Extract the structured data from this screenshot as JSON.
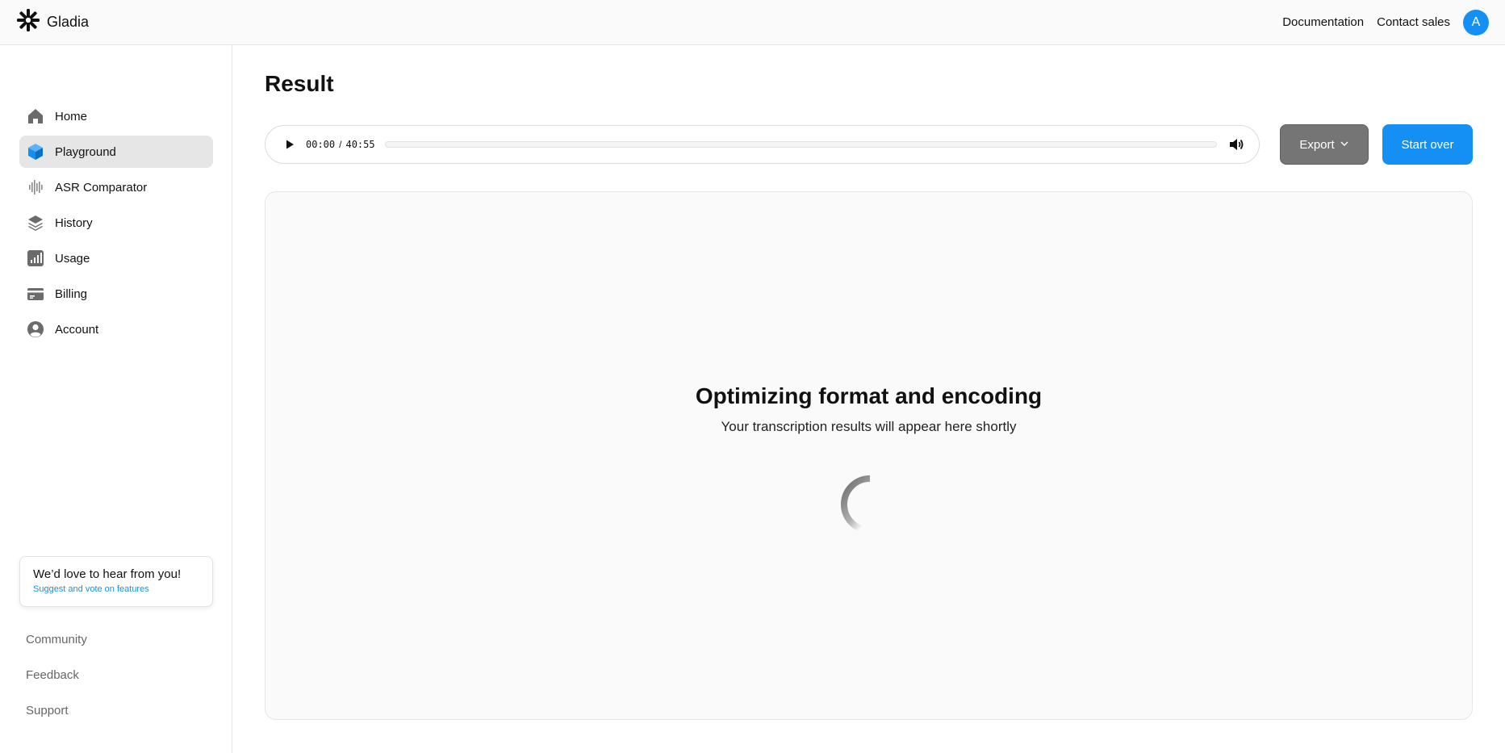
{
  "header": {
    "brand": "Gladia",
    "links": {
      "documentation": "Documentation",
      "contact_sales": "Contact sales"
    },
    "avatar_initial": "A"
  },
  "sidebar": {
    "items": [
      {
        "label": "Home",
        "icon": "home-icon",
        "active": false
      },
      {
        "label": "Playground",
        "icon": "cube-icon",
        "active": true
      },
      {
        "label": "ASR Comparator",
        "icon": "waveform-icon",
        "active": false
      },
      {
        "label": "History",
        "icon": "layers-icon",
        "active": false
      },
      {
        "label": "Usage",
        "icon": "bar-chart-icon",
        "active": false
      },
      {
        "label": "Billing",
        "icon": "credit-card-icon",
        "active": false
      },
      {
        "label": "Account",
        "icon": "user-circle-icon",
        "active": false
      }
    ],
    "feedback": {
      "title": "We’d love to hear from you!",
      "link": "Suggest and vote on features"
    },
    "bottom_links": [
      "Community",
      "Feedback",
      "Support"
    ]
  },
  "main": {
    "title": "Result",
    "player": {
      "current_time": "00:00",
      "separator": "/",
      "duration": "40:55",
      "progress": 0
    },
    "export_label": "Export",
    "start_over_label": "Start over",
    "status_title": "Optimizing format and encoding",
    "status_subtitle": "Your transcription results will appear here shortly"
  },
  "colors": {
    "accent": "#1490f5",
    "export_bg": "#757575",
    "active_nav_bg": "#e6e6e6",
    "panel_bg": "#fafafa"
  }
}
